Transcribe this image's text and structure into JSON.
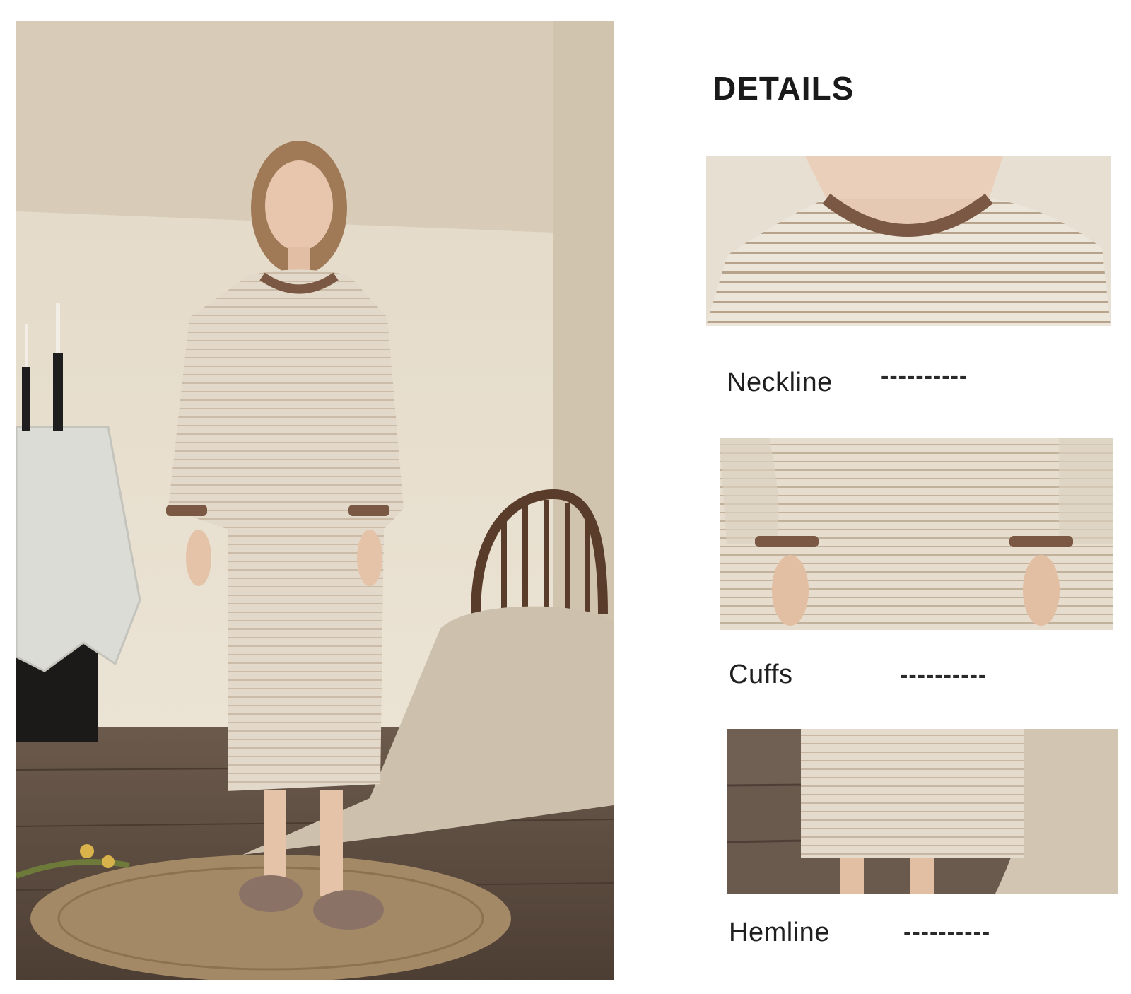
{
  "details": {
    "title": "DETAILS",
    "items": [
      {
        "label": "Neckline",
        "dash": "----------"
      },
      {
        "label": "Cuffs",
        "dash": "----------"
      },
      {
        "label": "Hemline",
        "dash": "----------"
      }
    ]
  },
  "colors": {
    "background": "#ffffff",
    "wall": "#e6dccb",
    "floor": "#5e4d41",
    "dress": "#e1d6c6",
    "trim": "#7a5843",
    "text": "#1a1a1a"
  }
}
